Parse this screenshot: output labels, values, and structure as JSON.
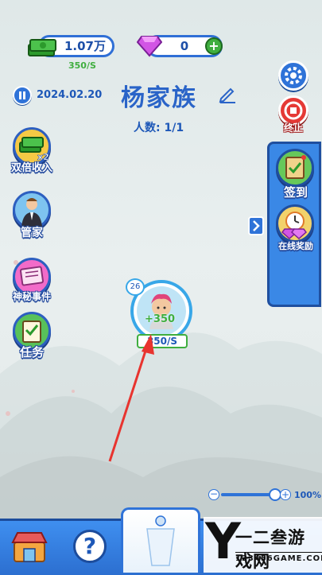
{
  "currency": {
    "money": "1.07万",
    "rate": "350/S",
    "gems": "0"
  },
  "header": {
    "date": "2024.02.20",
    "family_name": "杨家族",
    "population": "人数: 1/1"
  },
  "right_buttons": {
    "stop": "终止"
  },
  "left_menu": [
    {
      "label": "双倍收入",
      "icon": "cash-x2-icon",
      "badge": "x2"
    },
    {
      "label": "管家",
      "icon": "butler-icon"
    },
    {
      "label": "神秘事件",
      "icon": "mystery-book-icon"
    },
    {
      "label": "任务",
      "icon": "task-board-icon"
    }
  ],
  "right_panel": [
    {
      "label": "签到",
      "icon": "checkin-book-icon"
    },
    {
      "label": "在线奖励",
      "icon": "gem-clock-icon"
    }
  ],
  "character": {
    "level": "26",
    "gain": "+350",
    "income": "350/S"
  },
  "zoom": {
    "value": "100%",
    "level": 1.0
  },
  "watermark": {
    "brand": "Y",
    "title": "一二叁游戏网",
    "url": "123456GAME.COM"
  },
  "colors": {
    "primary_blue": "#2f73d8",
    "accent_green": "#3fae3f",
    "stop_red": "#e53935"
  }
}
